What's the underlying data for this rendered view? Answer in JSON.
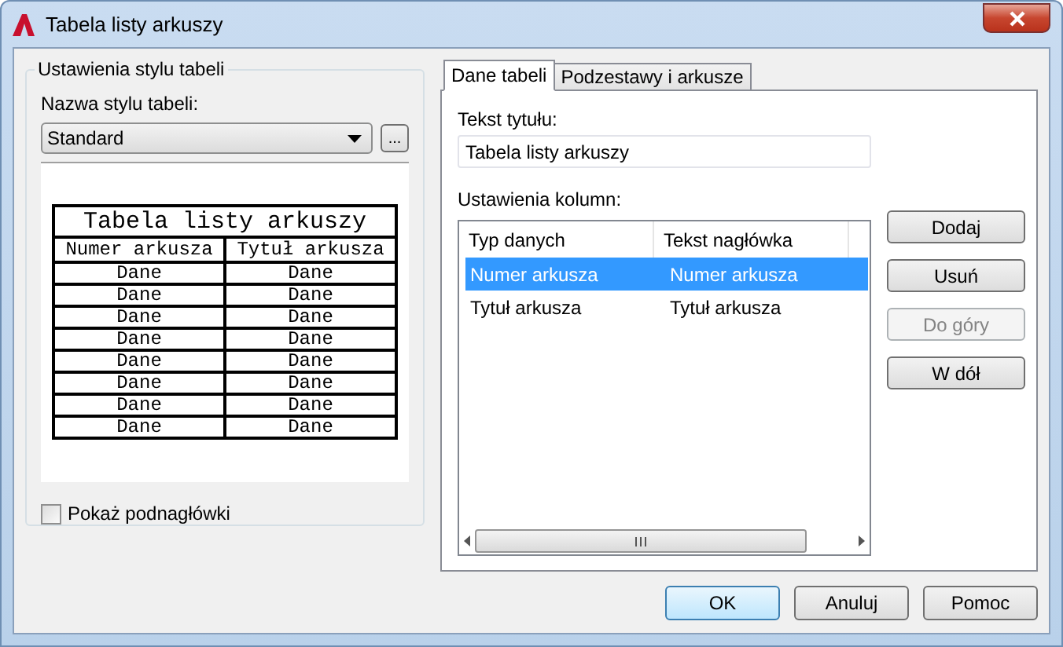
{
  "window": {
    "title": "Tabela listy arkuszy"
  },
  "style_settings": {
    "title": "Ustawienia stylu tabeli",
    "style_name_label": "Nazwa stylu tabeli:",
    "style_name": "Standard",
    "browse_button": "...",
    "preview": {
      "title": "Tabela listy arkuszy",
      "headers": [
        "Numer arkusza",
        "Tytuł arkusza"
      ],
      "rows": [
        [
          "Dane",
          "Dane"
        ],
        [
          "Dane",
          "Dane"
        ],
        [
          "Dane",
          "Dane"
        ],
        [
          "Dane",
          "Dane"
        ],
        [
          "Dane",
          "Dane"
        ],
        [
          "Dane",
          "Dane"
        ],
        [
          "Dane",
          "Dane"
        ],
        [
          "Dane",
          "Dane"
        ]
      ]
    },
    "show_subheaders": {
      "label": "Pokaż podnagłówki",
      "checked": false
    }
  },
  "tabs": [
    {
      "label": "Dane tabeli",
      "selected": true
    },
    {
      "label": "Podzestawy i arkusze",
      "selected": false
    }
  ],
  "title_text": {
    "label": "Tekst tytułu:",
    "value": "Tabela listy arkuszy"
  },
  "columns": {
    "label": "Ustawienia kolumn:",
    "headers": [
      "Typ danych",
      "Tekst nagłówka"
    ],
    "rows": [
      {
        "cells": [
          "Numer arkusza",
          "Numer arkusza"
        ],
        "selected": true
      },
      {
        "cells": [
          "Tytuł arkusza",
          "Tytuł arkusza"
        ],
        "selected": false
      }
    ]
  },
  "side_buttons": [
    {
      "label": "Dodaj",
      "disabled": false
    },
    {
      "label": "Usuń",
      "disabled": false
    },
    {
      "label": "Do góry",
      "disabled": true
    },
    {
      "label": "W dół",
      "disabled": false
    }
  ],
  "footer_buttons": [
    {
      "label": "OK",
      "default": true
    },
    {
      "label": "Anuluj",
      "default": false
    },
    {
      "label": "Pomoc",
      "default": false
    }
  ]
}
